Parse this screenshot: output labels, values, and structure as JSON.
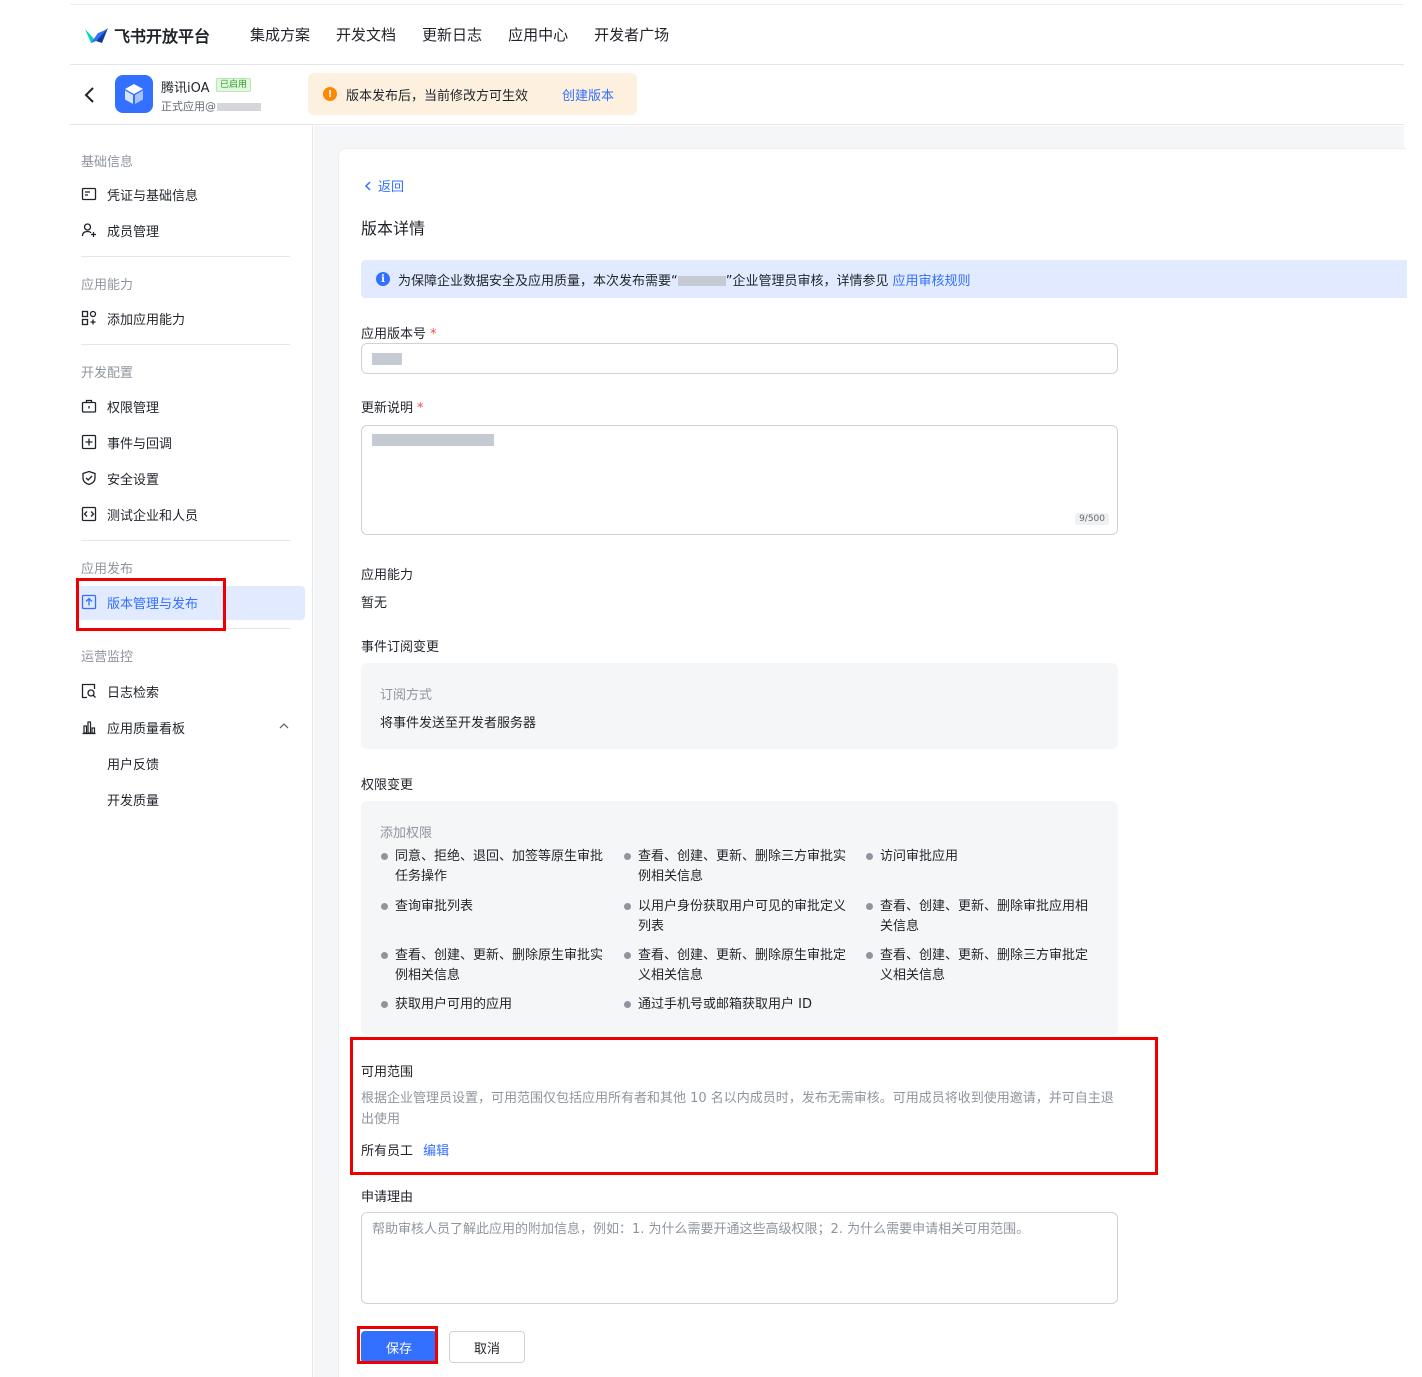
{
  "brand": {
    "name": "飞书开放平台"
  },
  "topnav": {
    "items": [
      "集成方案",
      "开发文档",
      "更新日志",
      "应用中心",
      "开发者广场"
    ]
  },
  "app": {
    "name": "腾讯iOA",
    "badge": "已启用",
    "sub": "正式应用@"
  },
  "notice": {
    "text": "版本发布后，当前修改方可生效",
    "link": "创建版本"
  },
  "sidebar": {
    "groups": {
      "basic": "基础信息",
      "capability": "应用能力",
      "dev": "开发配置",
      "publish": "应用发布",
      "ops": "运营监控"
    },
    "items": {
      "credentials": "凭证与基础信息",
      "members": "成员管理",
      "add_capability": "添加应用能力",
      "permissions": "权限管理",
      "events": "事件与回调",
      "security": "安全设置",
      "test_org": "测试企业和人员",
      "version": "版本管理与发布",
      "logs": "日志检索",
      "quality": "应用质量看板",
      "feedback": "用户反馈",
      "dev_quality": "开发质量"
    }
  },
  "main": {
    "back": "返回",
    "title": "版本详情",
    "info": {
      "text_before": "为保障企业数据安全及应用质量，本次发布需要“",
      "text_after": "”企业管理员审核，详情参见",
      "link": "应用审核规则"
    },
    "version_label": "应用版本号",
    "notes_label": "更新说明",
    "notes_counter": "9/500",
    "capability_label": "应用能力",
    "capability_value": "暂无",
    "event_label": "事件订阅变更",
    "event_box": {
      "title": "订阅方式",
      "value": "将事件发送至开发者服务器"
    },
    "perm_label": "权限变更",
    "perm_box": {
      "title": "添加权限",
      "items": [
        "同意、拒绝、退回、加签等原生审批任务操作",
        "查看、创建、更新、删除三方审批实例相关信息",
        "访问审批应用",
        "查询审批列表",
        "以用户身份获取用户可见的审批定义列表",
        "查看、创建、更新、删除审批应用相关信息",
        "查看、创建、更新、删除原生审批实例相关信息",
        "查看、创建、更新、删除原生审批定义相关信息",
        "查看、创建、更新、删除三方审批定义相关信息",
        "获取用户可用的应用",
        "通过手机号或邮箱获取用户 ID"
      ]
    },
    "scope_label": "可用范围",
    "scope_desc": "根据企业管理员设置，可用范围仅包括应用所有者和其他 10 名以内成员时，发布无需审核。可用成员将收到使用邀请，并可自主退出使用",
    "scope_value": "所有员工",
    "scope_edit": "编辑",
    "reason_label": "申请理由",
    "reason_placeholder": "帮助审核人员了解此应用的附加信息，例如：1. 为什么需要开通这些高级权限；2. 为什么需要申请相关可用范围。",
    "save": "保存",
    "cancel": "取消"
  },
  "colors": {
    "accent": "#3370ff",
    "annotation": "#ee0000",
    "warning": "#ff8800"
  }
}
